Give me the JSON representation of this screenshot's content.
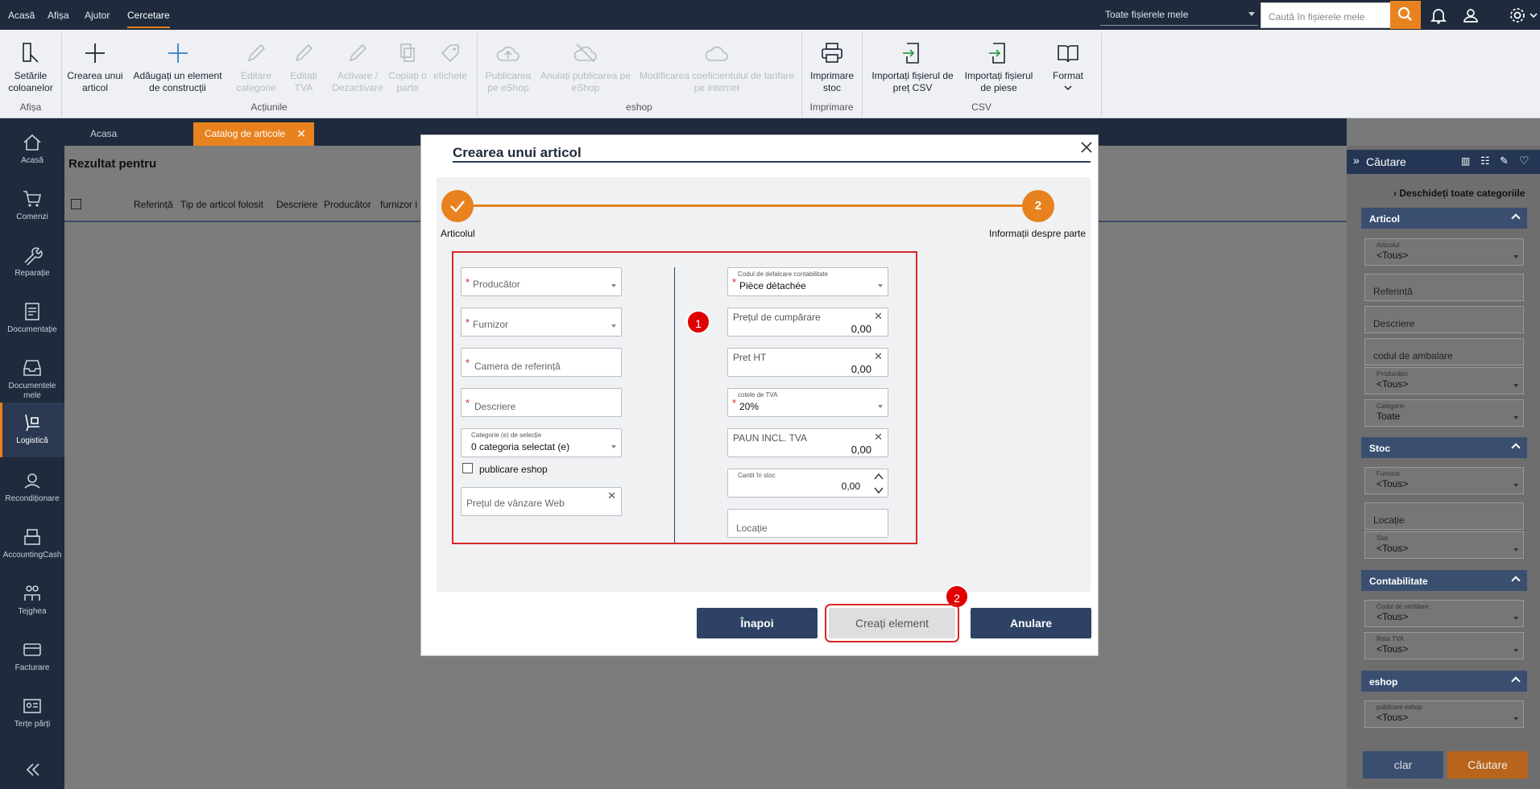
{
  "topbar": {
    "menu": [
      "Acasă",
      "Afișa",
      "Ajutor",
      "Cercetare"
    ],
    "active_menu": "Cercetare",
    "file_scope": "Toate fișierele mele",
    "search_placeholder": "Caută în fișierele mele"
  },
  "ribbon": {
    "buttons": [
      {
        "label": "Setările coloanelor",
        "icon": "column-settings-icon",
        "enabled": true
      },
      {
        "label": "Crearea unui articol",
        "icon": "plus-icon",
        "enabled": true
      },
      {
        "label": "Adăugați un element de construcții",
        "icon": "plus-icon",
        "enabled": true
      },
      {
        "label": "Editare categorie",
        "icon": "pencil-icon",
        "enabled": false
      },
      {
        "label": "Editați TVA",
        "icon": "pencil-icon",
        "enabled": false
      },
      {
        "label": "Activare / Dezactivare",
        "icon": "pencil-icon",
        "enabled": false
      },
      {
        "label": "Copiați o parte",
        "icon": "copy-icon",
        "enabled": false
      },
      {
        "label": "etichete",
        "icon": "tag-icon",
        "enabled": false
      },
      {
        "label": "Publicarea pe eShop",
        "icon": "cloud-upload-icon",
        "enabled": false
      },
      {
        "label": "Anulați publicarea pe eShop",
        "icon": "cloud-off-icon",
        "enabled": false
      },
      {
        "label": "Modificarea coeficientului de tarifare pe internet",
        "icon": "cloud-icon",
        "enabled": false
      },
      {
        "label": "Imprimare stoc",
        "icon": "printer-icon",
        "enabled": true
      },
      {
        "label": "Importați fișierul de preț CSV",
        "icon": "import-icon",
        "enabled": true
      },
      {
        "label": "Importați fișierul de piese",
        "icon": "import-icon",
        "enabled": true
      },
      {
        "label": "Format",
        "icon": "book-icon",
        "enabled": true
      }
    ],
    "groups": [
      "Afișa",
      "Acțiunile",
      "eshop",
      "Imprimare",
      "CSV"
    ]
  },
  "leftnav": [
    {
      "label": "Acasă",
      "icon": "home-icon"
    },
    {
      "label": "Comenzi",
      "icon": "cart-icon"
    },
    {
      "label": "Reparație",
      "icon": "wrench-icon"
    },
    {
      "label": "Documentație",
      "icon": "document-icon"
    },
    {
      "label": "Documentele mele",
      "icon": "inbox-icon"
    },
    {
      "label": "Logistică",
      "icon": "logistics-icon"
    },
    {
      "label": "Recondiționare",
      "icon": "recycle-icon"
    },
    {
      "label": "AccountingCash",
      "icon": "cash-register-icon"
    },
    {
      "label": "Tejghea",
      "icon": "counter-icon"
    },
    {
      "label": "Facturare",
      "icon": "card-icon"
    },
    {
      "label": "Terțe părți",
      "icon": "contact-icon"
    }
  ],
  "leftnav_active": "Logistică",
  "tabs": [
    {
      "label": "Acasa"
    },
    {
      "label": "Catalog de articole"
    }
  ],
  "main": {
    "result_title": "Rezultat pentru",
    "columns": [
      "Referință",
      "Tip de articol folosit",
      "Descriere",
      "Producător",
      "furnizor i"
    ]
  },
  "rightpanel": {
    "title": "Căutare",
    "open_all": "Deschideți toate categoriile",
    "sections": [
      {
        "title": "Articol",
        "fields": [
          {
            "small": "Articolul",
            "value": "<Tous>"
          },
          {
            "placeholder": "Referință"
          },
          {
            "placeholder": "Descriere"
          },
          {
            "placeholder": "codul de ambalare"
          },
          {
            "small": "Producător",
            "value": "<Tous>"
          },
          {
            "small": "Categorie",
            "value": "Toate"
          }
        ]
      },
      {
        "title": "Stoc",
        "fields": [
          {
            "small": "Furnizor",
            "value": "<Tous>"
          },
          {
            "placeholder": "Locație"
          },
          {
            "small": "Stat",
            "value": "<Tous>"
          }
        ]
      },
      {
        "title": "Contabilitate",
        "fields": [
          {
            "small": "Codul de ventilare",
            "value": "<Tous>"
          },
          {
            "small": "Rata TVA",
            "value": "<Tous>"
          }
        ]
      },
      {
        "title": "eshop",
        "fields": [
          {
            "small": "publicare eshop",
            "value": "<Tous>"
          }
        ]
      }
    ],
    "clear_label": "clar",
    "search_label": "Căutare"
  },
  "modal": {
    "title": "Crearea unui articol",
    "step1_label": "Articolul",
    "step2_number": "2",
    "step2_label": "Informații despre parte",
    "left": {
      "producer": "Producător",
      "supplier": "Furnizor",
      "reference": "Camera de referință",
      "description": "Descriere",
      "category_small": "Categorie (e) de selecție",
      "category_value": "0 categoria selectat (e)",
      "eshop_checkbox": "publicare eshop",
      "web_price": "Prețul de vânzare Web"
    },
    "right": {
      "accounting_small": "Codul de defalcare contabilitate",
      "accounting_value": "Pièce détachée",
      "purchase_price_label": "Prețul de cumpărare",
      "purchase_price_value": "0,00",
      "price_ht_label": "Pret HT",
      "price_ht_value": "0,00",
      "vat_small": "cotele de TVA",
      "vat_value": "20%",
      "price_ttc_label": "PAUN INCL. TVA",
      "price_ttc_value": "0,00",
      "stock_small": "Cantit în stoc",
      "stock_value": "0,00",
      "location": "Locație"
    },
    "badge1": "1",
    "badge2": "2",
    "back_label": "Înapoi",
    "create_label": "Creați element",
    "cancel_label": "Anulare"
  },
  "colors": {
    "accent": "#e8821e",
    "navy": "#1f2a3d",
    "annotation": "#d62828"
  }
}
